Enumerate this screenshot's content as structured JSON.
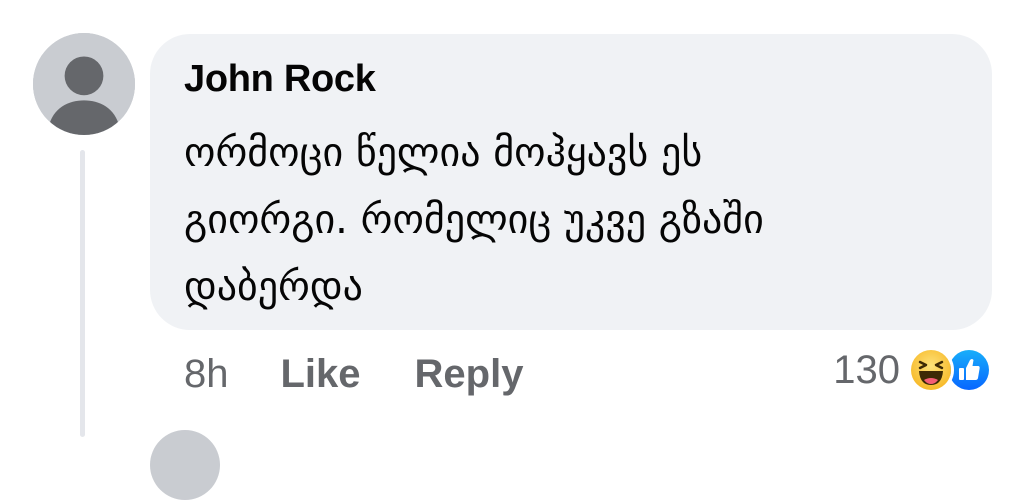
{
  "comment": {
    "author": "John Rock",
    "text_lines": [
      "ორმოცი წელია მოჰყავს ეს",
      "გიორგი. რომელიც უკვე გზაში",
      "დაბერდა"
    ],
    "time": "8h",
    "like_label": "Like",
    "reply_label": "Reply",
    "reaction_count": "130",
    "reactions": [
      "haha-reaction-icon",
      "like-reaction-icon"
    ]
  },
  "colors": {
    "bubble_bg": "#f0f2f5",
    "meta_text": "#65676b",
    "text": "#050505",
    "like_blue": "#1877f2",
    "haha_yellow": "#f7b928"
  }
}
